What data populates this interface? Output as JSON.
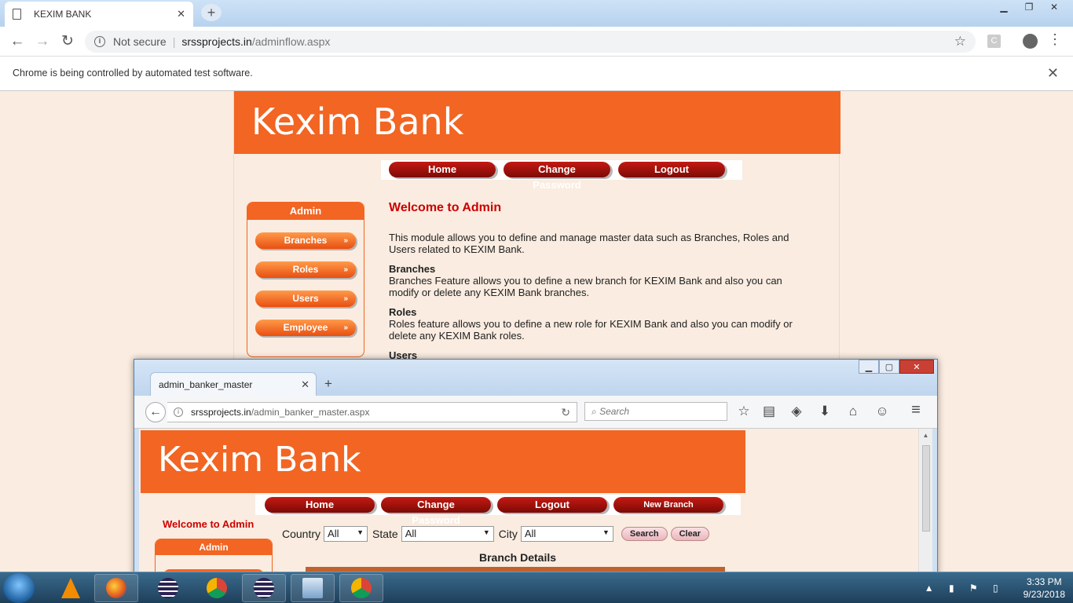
{
  "chrome": {
    "tab_title": "KEXIM BANK",
    "tab_close": "✕",
    "new_tab": "+",
    "win_min": "▁",
    "win_max": "❐",
    "win_close": "✕",
    "back": "←",
    "forward": "→",
    "reload": "↻",
    "not_secure": "Not secure",
    "separator": "|",
    "url_host": "srssprojects.in",
    "url_path": "/adminflow.aspx",
    "star": "☆",
    "ext_label": "C",
    "menu": "⋮",
    "infobar_text": "Chrome is being controlled by automated test software.",
    "infobar_close": "✕"
  },
  "page": {
    "bank_name": "Kexim Bank",
    "menu": [
      "Home",
      "Change Password",
      "Logout"
    ],
    "admin_title": "Admin",
    "side_buttons": [
      "Branches",
      "Roles",
      "Users",
      "Employee"
    ],
    "arrow": "»",
    "welcome_title": "Welcome to Admin",
    "intro": "This module allows you to define and manage master data such as Branches, Roles and Users related to KEXIM Bank.",
    "sections": [
      {
        "heading": "Branches",
        "text": "Branches Feature allows you to define a new branch for KEXIM Bank and also you can modify or delete any KEXIM Bank branches."
      },
      {
        "heading": "Roles",
        "text": "Roles feature allows you to define a new role for KEXIM Bank and also you can modify or delete any KEXIM Bank roles."
      },
      {
        "heading": "Users",
        "text": ""
      }
    ]
  },
  "firefox": {
    "tab_title": "admin_banker_master",
    "tab_close": "✕",
    "new_tab": "+",
    "win_min": "▁",
    "win_max": "▢",
    "win_close": "✕",
    "back": "←",
    "url_host": "srssprojects.in",
    "url_path": "/admin_banker_master.aspx",
    "reload": "↻",
    "search_placeholder": "Search",
    "icons": [
      "star-icon",
      "reading-list-icon",
      "pocket-icon",
      "download-icon",
      "home-icon",
      "smiley-icon",
      "hamburger-menu-icon"
    ],
    "icon_glyphs": [
      "☆",
      "▤",
      "◈",
      "⬇",
      "⌂",
      "☺",
      "≡"
    ]
  },
  "inner_page": {
    "bank_name": "Kexim Bank",
    "menu": [
      "Home",
      "Change Password",
      "Logout",
      "New Branch"
    ],
    "welcome": "Welcome to Admin",
    "admin_title": "Admin",
    "filters": {
      "country_label": "Country",
      "country_value": "All",
      "state_label": "State",
      "state_value": "All",
      "city_label": "City",
      "city_value": "All",
      "dropdown_glyph": "▼"
    },
    "search_button": "Search",
    "clear_button": "Clear",
    "branch_details_title": "Branch Details"
  },
  "taskbar": {
    "apps": [
      "vlc-icon",
      "firefox-icon",
      "eclipse-icon",
      "chrome-icon",
      "eclipse-icon",
      "network-icon",
      "chrome-icon"
    ],
    "tray_icons": "▲ ▮ ⚑ ▯",
    "time": "3:33 PM",
    "date": "9/23/2018"
  },
  "colors": {
    "brand_orange": "#f26522",
    "button_red": "#9e120c",
    "welcome_red": "#cc0000",
    "page_bg": "#faece0"
  }
}
